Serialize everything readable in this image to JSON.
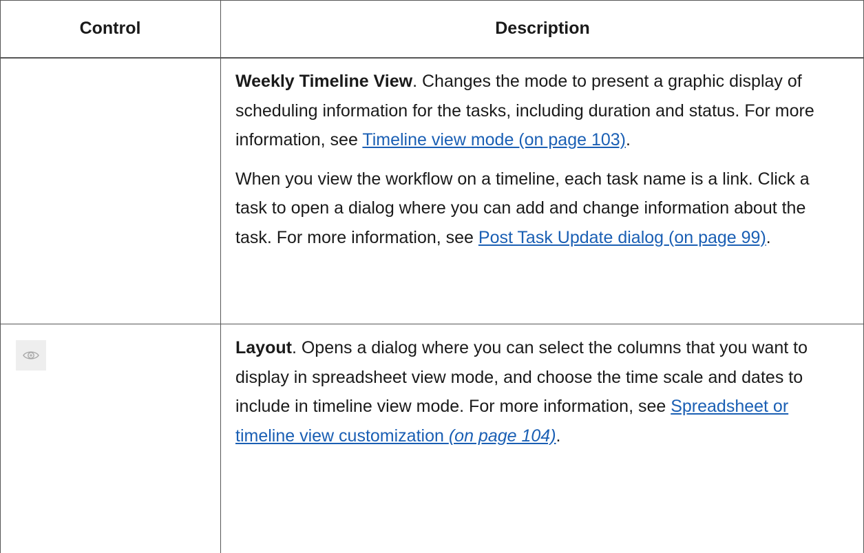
{
  "table": {
    "headers": {
      "control": "Control",
      "description": "Description"
    },
    "rows": [
      {
        "control_icon": "",
        "title": "Weekly Timeline View",
        "p1_text": ". Changes the mode to present a graphic display of scheduling information for the tasks, including duration and status. For more information, see ",
        "p1_link": "Timeline view mode (on page 103)",
        "p1_end": ".",
        "p2_text": "When you view the workflow on a timeline, each task name is a link. Click a task to open a dialog where you can add and change information about the task. For more information, see ",
        "p2_link": "Post Task Update dialog (on page 99)",
        "p2_end": "."
      },
      {
        "control_icon": "eye-icon",
        "title": "Layout",
        "p1_text": ". Opens a dialog where you can select the columns that you want to display in spreadsheet view mode, and choose the time scale and dates to include in timeline view mode. For more information, see ",
        "p1_link_main": "Spreadsheet or timeline view customization ",
        "p1_link_italic": "(on page 104)",
        "p1_end": "."
      }
    ]
  }
}
